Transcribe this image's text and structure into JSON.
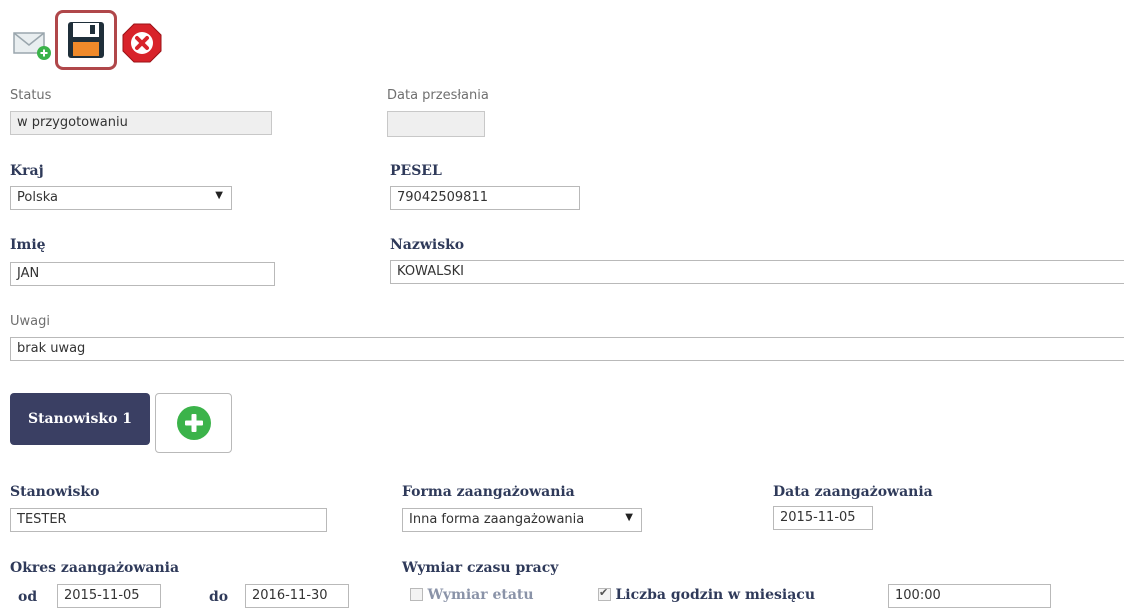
{
  "toolbar": {
    "send_icon": "envelope-plus-icon",
    "save_icon": "floppy-disk-icon",
    "delete_icon": "red-x-icon"
  },
  "form": {
    "status_label": "Status",
    "status_value": "w przygotowaniu",
    "data_przeslania_label": "Data przesłania",
    "data_przeslania_value": "",
    "kraj_label": "Kraj",
    "kraj_value": "Polska",
    "pesel_label": "PESEL",
    "pesel_value": "79042509811",
    "imie_label": "Imię",
    "imie_value": "JAN",
    "nazwisko_label": "Nazwisko",
    "nazwisko_value": "KOWALSKI",
    "uwagi_label": "Uwagi",
    "uwagi_value": "brak uwag"
  },
  "positions": {
    "tab_label": "Stanowisko 1",
    "add_icon": "plus-circle-icon"
  },
  "position": {
    "stanowisko_label": "Stanowisko",
    "stanowisko_value": "TESTER",
    "forma_label": "Forma zaangażowania",
    "forma_value": "Inna forma zaangażowania",
    "data_zaang_label": "Data zaangażowania",
    "data_zaang_value": "2015-11-05",
    "okres_label": "Okres zaangażowania",
    "od_label": "od",
    "od_value": "2015-11-05",
    "do_label": "do",
    "do_value": "2016-11-30",
    "wymiar_label": "Wymiar czasu pracy",
    "wymiar_etatu_label": "Wymiar etatu",
    "wymiar_etatu_checked": false,
    "liczba_godzin_label": "Liczba godzin w miesiącu",
    "liczba_godzin_checked": true,
    "liczba_godzin_value": "100:00"
  },
  "colors": {
    "accent_dark": "#3a3f63",
    "save_highlight": "#b0474a",
    "add_green": "#3bb34a",
    "delete_red": "#d8232a"
  }
}
